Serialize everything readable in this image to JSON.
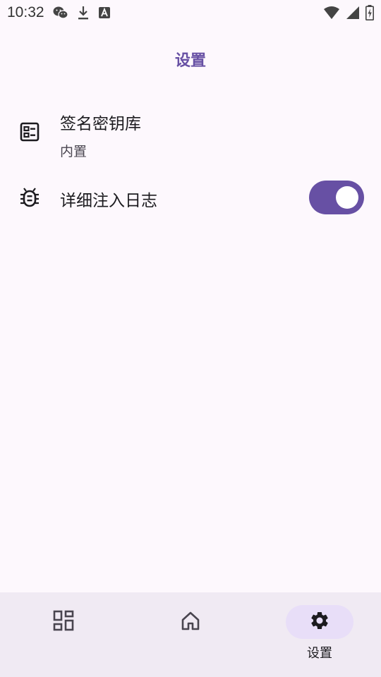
{
  "status_bar": {
    "time": "10:32",
    "left_icons": [
      "wechat-icon",
      "download-icon",
      "font-a-icon"
    ],
    "right_icons": [
      "wifi-icon",
      "signal-icon",
      "battery-charging-icon"
    ]
  },
  "app_bar": {
    "title": "设置"
  },
  "settings": [
    {
      "title": "签名密钥库",
      "subtitle": "内置",
      "icon": "keystore-icon"
    },
    {
      "title": "详细注入日志",
      "icon": "bug-icon",
      "switch_on": true
    }
  ],
  "bottom_nav": {
    "items": [
      {
        "icon": "dashboard-icon",
        "label": ""
      },
      {
        "icon": "home-icon",
        "label": ""
      },
      {
        "icon": "settings-gear-icon",
        "label": "设置",
        "active": true
      }
    ]
  },
  "colors": {
    "accent": "#6750a4",
    "background": "#fdf8fd",
    "nav_background": "#f0eaf3",
    "nav_indicator": "#e8def8"
  }
}
